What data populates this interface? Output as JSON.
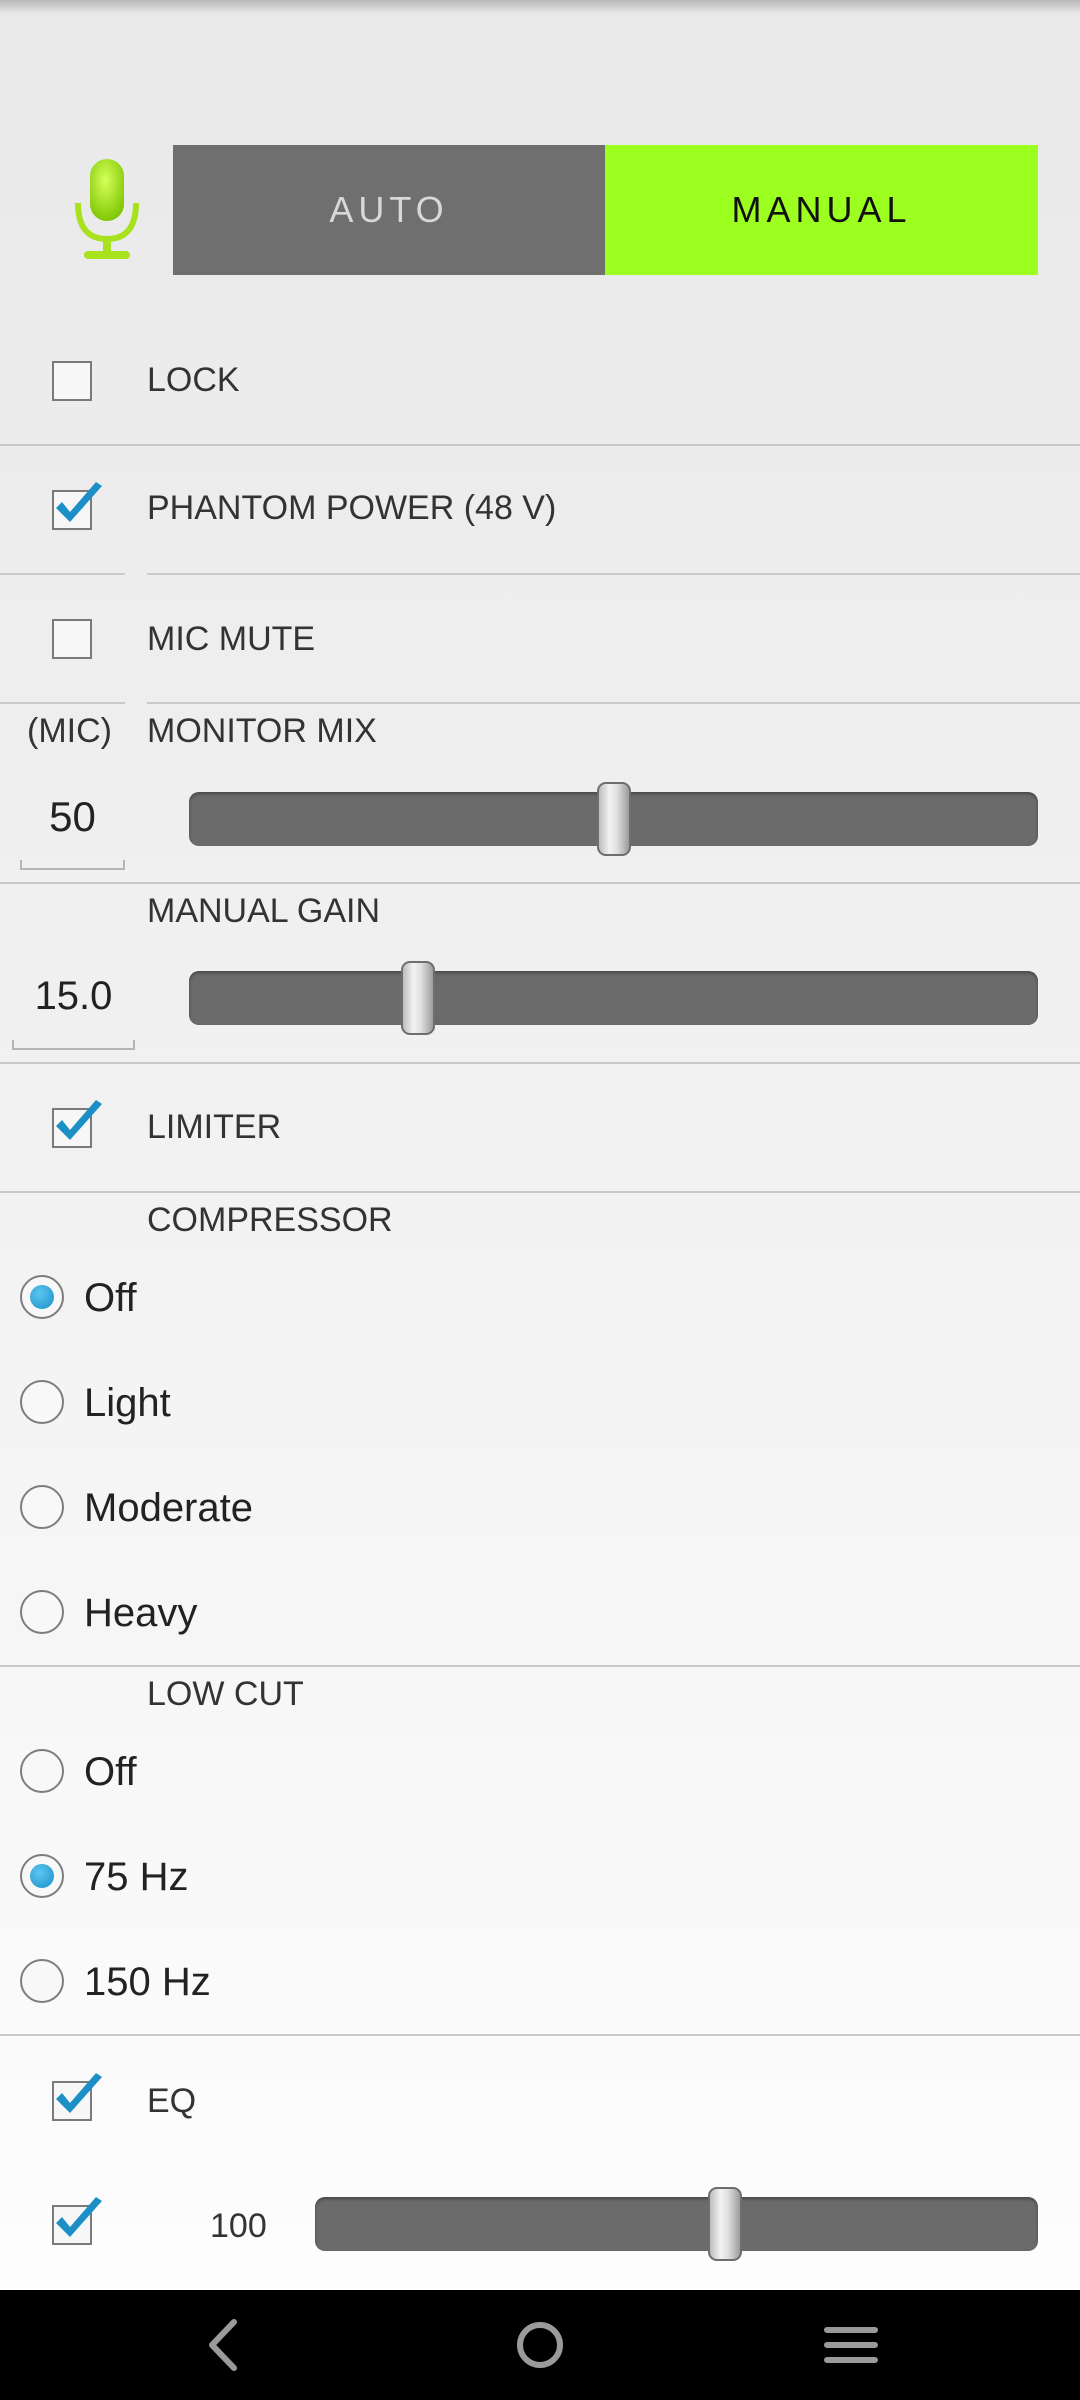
{
  "mode": {
    "auto_label": "AUTO",
    "manual_label": "MANUAL",
    "selected": "MANUAL",
    "active_color": "#9cff1f",
    "inactive_color": "#6f6f6f"
  },
  "icons": {
    "mic": "microphone-icon",
    "check": "checkmark-icon",
    "nav_back": "back-icon",
    "nav_home": "home-icon",
    "nav_menu": "menu-icon"
  },
  "lock": {
    "label": "LOCK",
    "checked": false
  },
  "phantom_power": {
    "label": "PHANTOM POWER (48 V)",
    "checked": true
  },
  "mic_mute": {
    "label": "MIC MUTE",
    "checked": false
  },
  "monitor_mix": {
    "side_label": "(MIC)",
    "label": "MONITOR MIX",
    "value": "50",
    "level_fraction": 0.5
  },
  "manual_gain": {
    "label": "MANUAL GAIN",
    "value": "15.0",
    "level_fraction": 0.26
  },
  "limiter": {
    "label": "LIMITER",
    "checked": true
  },
  "compressor": {
    "label": "COMPRESSOR",
    "options": [
      "Off",
      "Light",
      "Moderate",
      "Heavy"
    ],
    "selected": "Off"
  },
  "low_cut": {
    "label": "LOW CUT",
    "options": [
      "Off",
      "75 Hz",
      "150 Hz"
    ],
    "selected": "75 Hz"
  },
  "eq": {
    "label": "EQ",
    "checked": true
  },
  "eq_band": {
    "checked": true,
    "value": "100",
    "level_fraction": 0.57
  },
  "accent_color": "#1b8fc6"
}
